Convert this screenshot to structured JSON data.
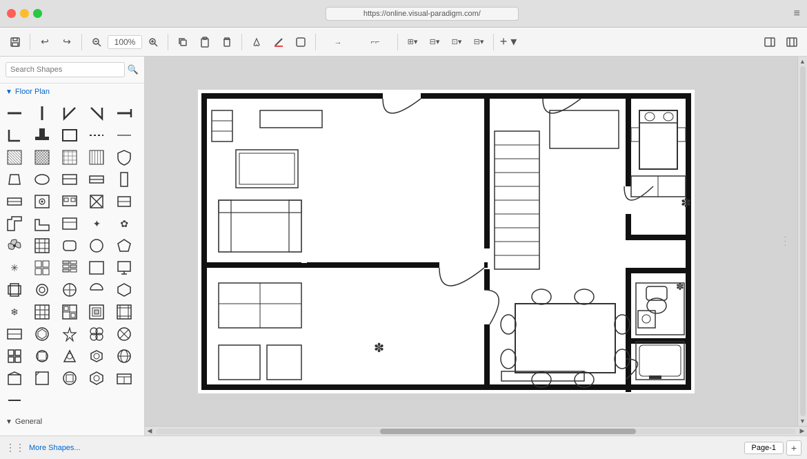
{
  "titlebar": {
    "url": "https://online.visual-paradigm.com/"
  },
  "toolbar": {
    "zoom_value": "100%",
    "buttons": [
      "save",
      "undo",
      "redo",
      "zoom-out",
      "zoom",
      "zoom-in",
      "copy",
      "paste",
      "delete",
      "fill",
      "line-color",
      "shape",
      "connector",
      "waypoint",
      "arrange",
      "layer",
      "insert"
    ]
  },
  "sidebar": {
    "search_placeholder": "Search Shapes",
    "categories": [
      {
        "name": "Floor Plan",
        "expanded": true
      },
      {
        "name": "General",
        "expanded": false
      }
    ]
  },
  "canvas": {
    "background": "#d4d4d4"
  },
  "bottombar": {
    "more_shapes_label": "More Shapes...",
    "page_name": "Page-1",
    "add_page_label": "+"
  },
  "shapes": {
    "floor_plan": [
      "─",
      "│",
      "┌",
      "┐",
      "└",
      "┘",
      "┬",
      "┼",
      "▭",
      "─ ─",
      "░",
      "▦",
      "▧",
      "▨",
      "◖",
      "◗",
      "⌒",
      "▬",
      "▭",
      "▯",
      "▰",
      "▱",
      "▲",
      "△",
      "▴",
      "▵",
      "▸",
      "▹",
      "►",
      "▻",
      "◆",
      "◇",
      "◈",
      "◉",
      "◊",
      "○",
      "◌",
      "◍",
      "◎",
      "●",
      "◐",
      "◑",
      "◒",
      "◓",
      "◔",
      "◕",
      "◖",
      "◗",
      "◘",
      "◙",
      "◚",
      "◛",
      "◜",
      "◝",
      "◞",
      "◟",
      "◠",
      "◡",
      "◢",
      "◣",
      "◤",
      "◥",
      "◦",
      "◧",
      "◨",
      "◩",
      "◪",
      "◫",
      "◬",
      "◭",
      "◮",
      "◯",
      "◰",
      "◱",
      "◲",
      "◳",
      "◴",
      "◵",
      "◶",
      "◷"
    ]
  }
}
